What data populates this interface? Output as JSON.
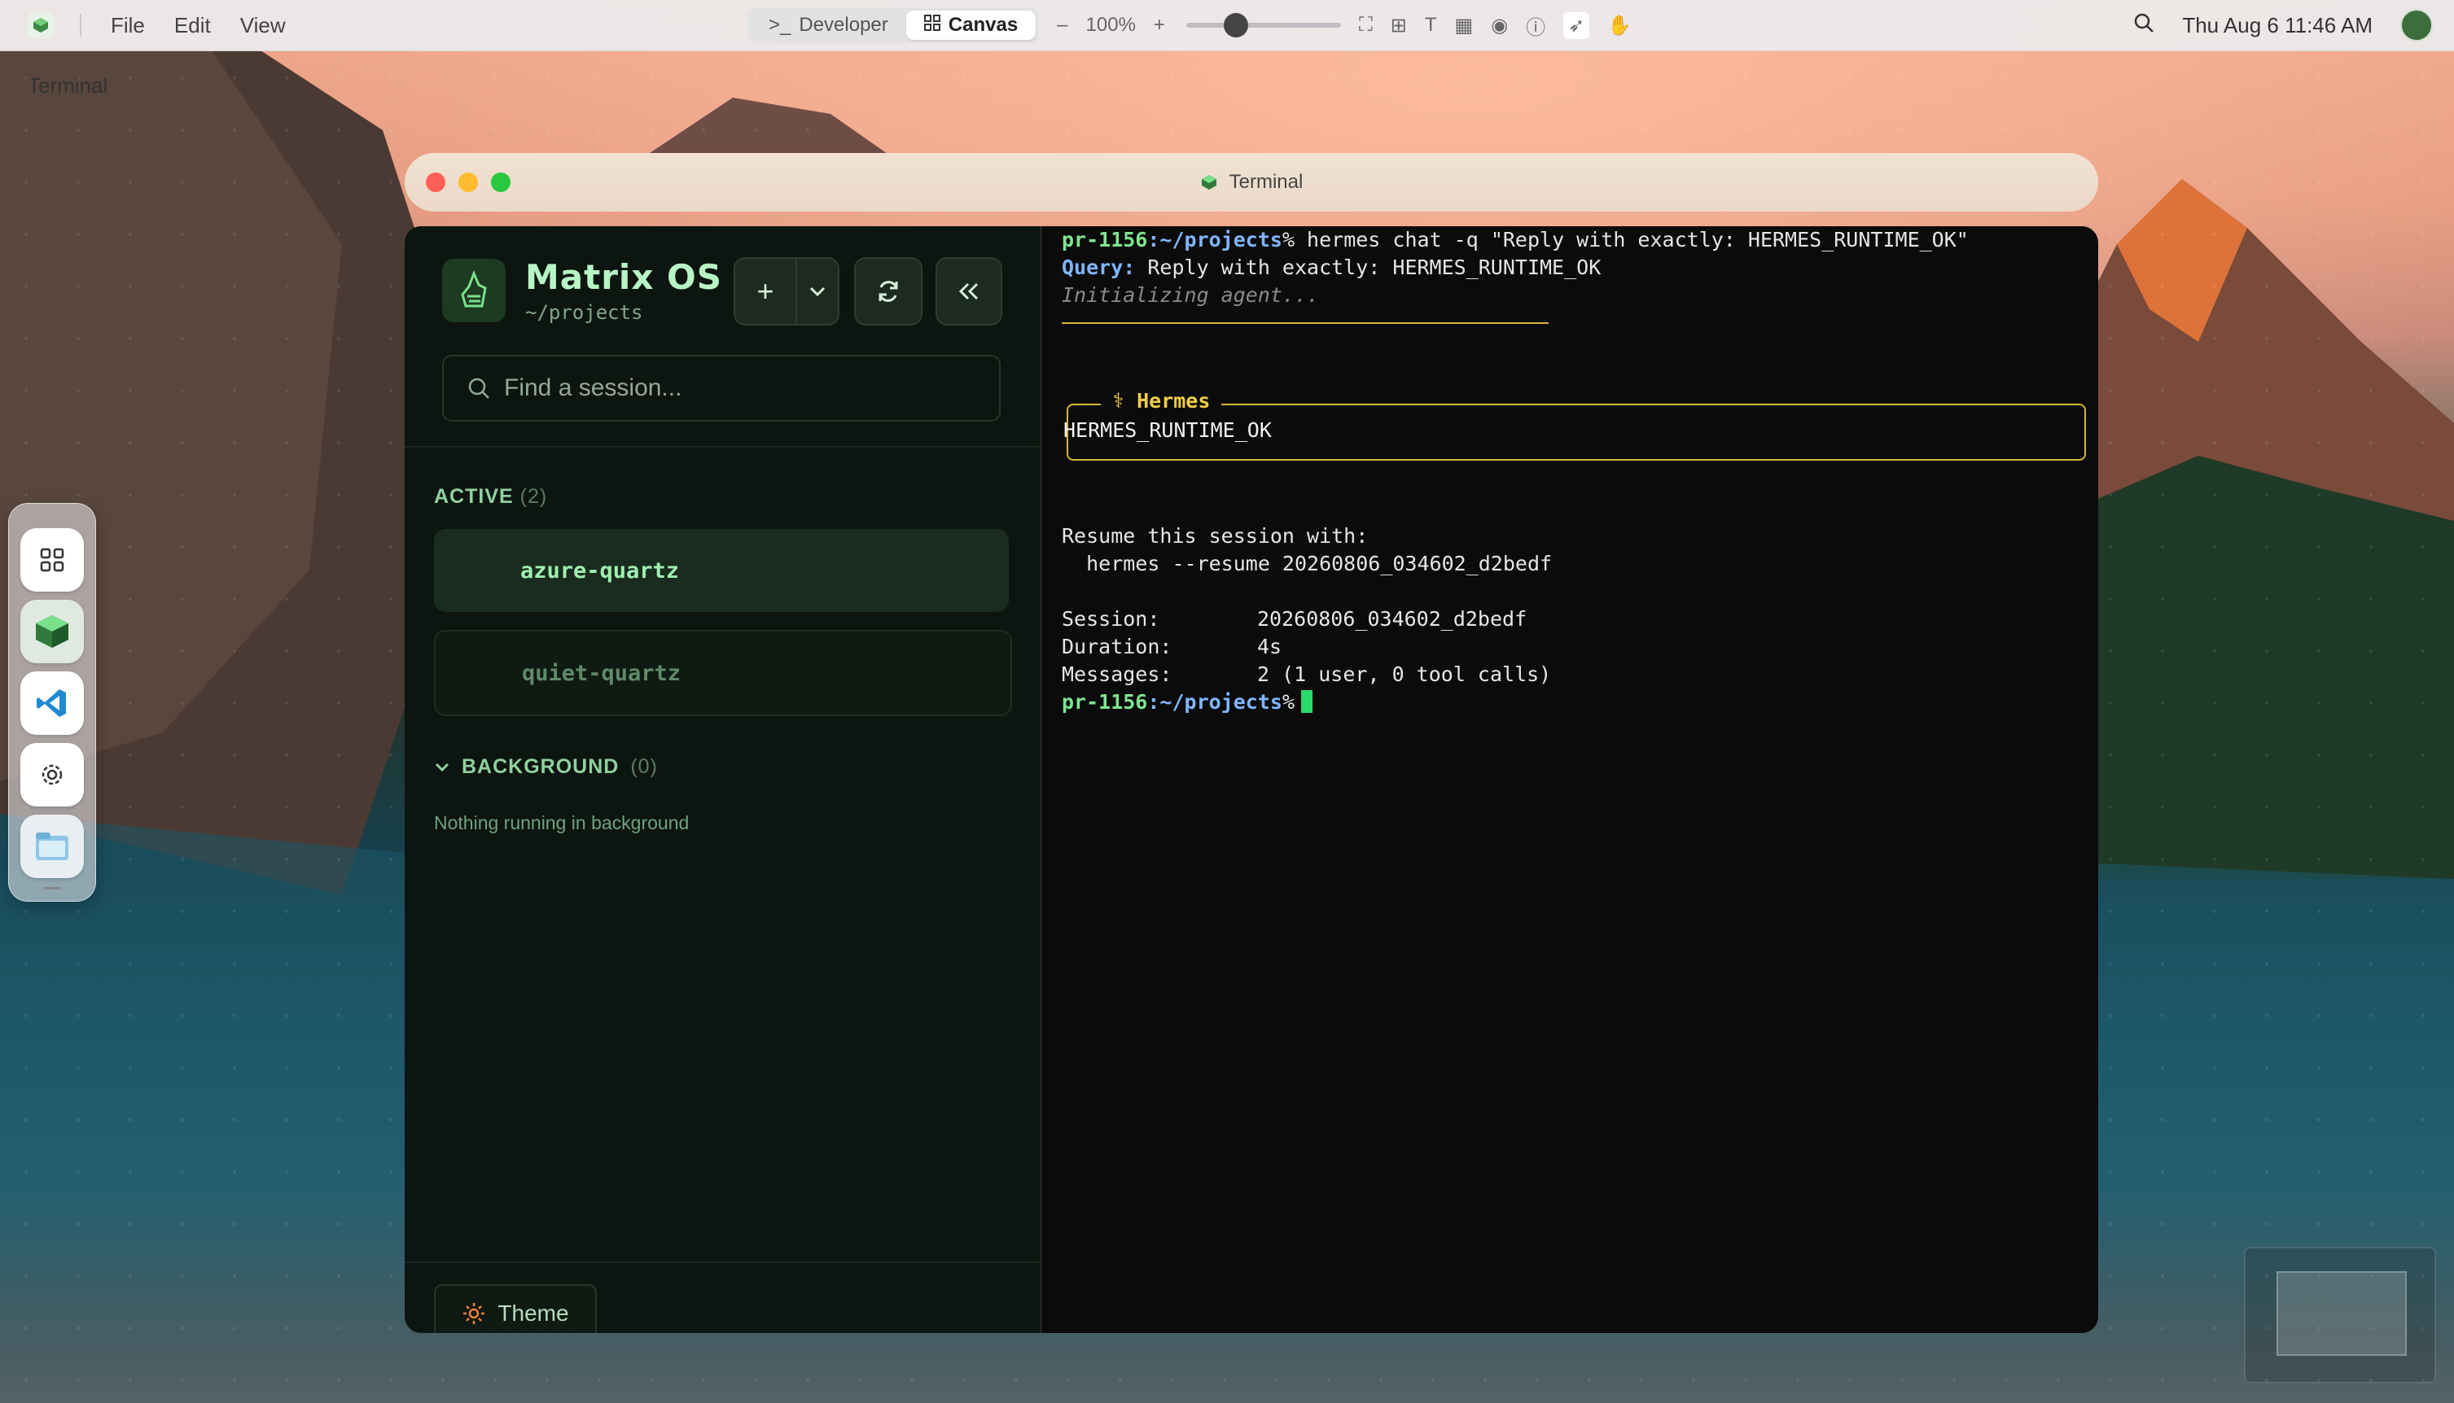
{
  "menubar": {
    "app_name": "Terminal",
    "menus": [
      "File",
      "Edit",
      "View"
    ],
    "mode_developer": "Developer",
    "mode_canvas": "Canvas",
    "zoom": "100%",
    "zoom_out_label": "–",
    "zoom_in_label": "+",
    "datetime": "Thu Aug 6  11:46 AM"
  },
  "window": {
    "title": "Terminal"
  },
  "sidebar": {
    "brand_title": "Matrix OS",
    "brand_path": "~/projects",
    "new_label": "+",
    "search_placeholder": "Find a session...",
    "active_heading": "ACTIVE",
    "active_count": "(2)",
    "sessions": [
      {
        "name": "azure-quartz",
        "state": "active"
      },
      {
        "name": "quiet-quartz",
        "state": "idle"
      }
    ],
    "background_heading": "BACKGROUND",
    "background_count": "(0)",
    "background_empty": "Nothing running in background",
    "theme_label": "Theme"
  },
  "terminal": {
    "prompt_user": "pr-1156",
    "prompt_path": ":~/projects",
    "prompt_suffix": "%",
    "command": " hermes chat -q \"Reply with exactly: HERMES_RUNTIME_OK\"",
    "query_label": "Query:",
    "query_text": " Reply with exactly: HERMES_RUNTIME_OK",
    "initializing": "Initializing agent...",
    "hermes_label": "⚕ Hermes",
    "hermes_output": "HERMES_RUNTIME_OK",
    "resume_heading": "Resume this session with:",
    "resume_command": "  hermes --resume 20260806_034602_d2bedf",
    "session_label": "Session:",
    "session_value": "20260806_034602_d2bedf",
    "duration_label": "Duration:",
    "duration_value": "4s",
    "messages_label": "Messages:",
    "messages_value": "2 (1 user, 0 tool calls)"
  },
  "colors": {
    "accent_green": "#7fe58f",
    "path_blue": "#7fb6ff",
    "hermes_gold": "#d8b33a",
    "cursor": "#29d96a"
  }
}
